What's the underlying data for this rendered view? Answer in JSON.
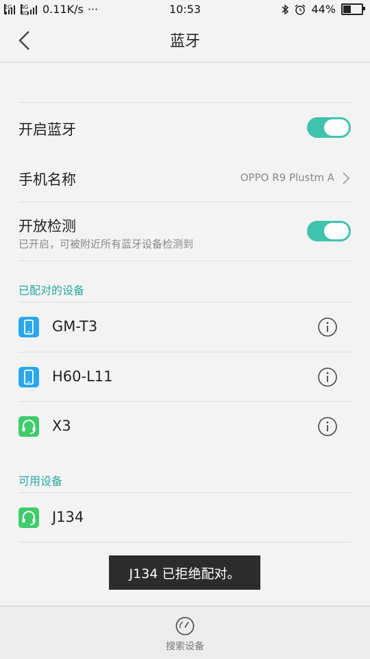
{
  "status": {
    "net_left": "2G",
    "net_right": "4G 4G",
    "speed": "0.11K/s",
    "more": "···",
    "time": "10:53",
    "battery_pct": "44%",
    "battery_level": 0.44
  },
  "header": {
    "title": "蓝牙"
  },
  "settings": {
    "bt_label": "开启蓝牙",
    "bt_on": true,
    "name_label": "手机名称",
    "name_value": "OPPO R9 Plustm A",
    "visible_label": "开放检测",
    "visible_sub": "已开启，可被附近所有蓝牙设备检测到",
    "visible_on": true
  },
  "paired": {
    "section": "已配对的设备",
    "devices": [
      {
        "name": "GM-T3",
        "icon": "phone-icon",
        "color": "#2ba8ea"
      },
      {
        "name": "H60-L11",
        "icon": "phone-icon",
        "color": "#2ba8ea"
      },
      {
        "name": "X3",
        "icon": "headset-icon",
        "color": "#3fcc6b"
      }
    ]
  },
  "available": {
    "section": "可用设备",
    "devices": [
      {
        "name": "J134",
        "icon": "headset-icon",
        "color": "#3fcc6b"
      }
    ]
  },
  "toast": "J134 已拒绝配对。",
  "bottom": {
    "search_label": "搜索设备"
  },
  "colors": {
    "accent": "#3fc3ad",
    "section": "#26a9a0"
  }
}
